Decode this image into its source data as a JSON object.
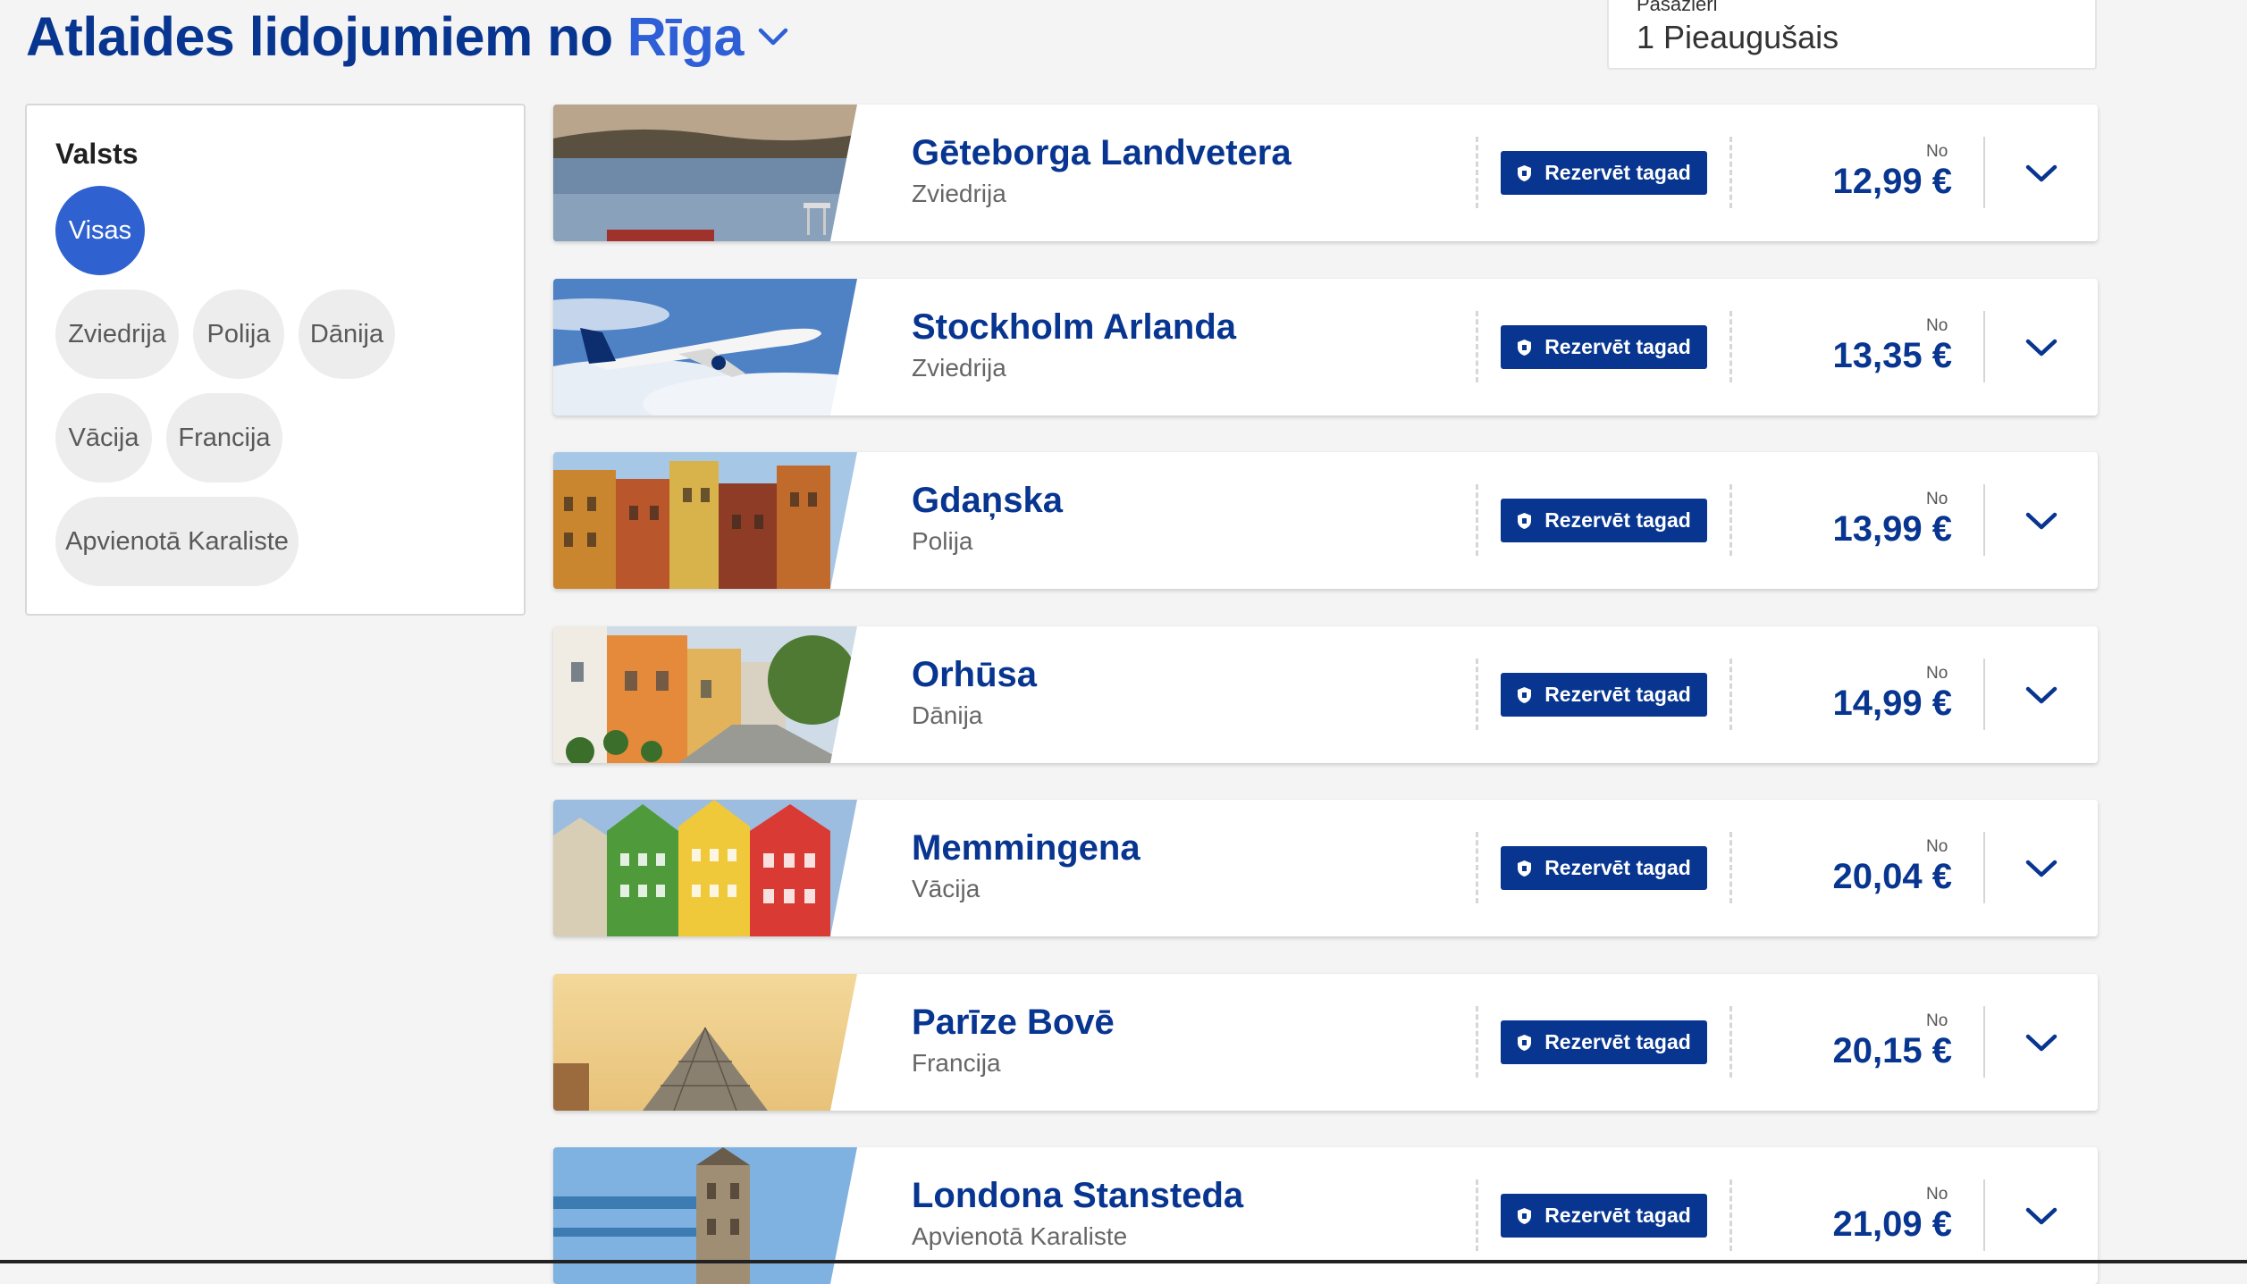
{
  "header": {
    "title_prefix": "Atlaides lidojumiem no",
    "origin_city": "Rīga",
    "passengers_label": "Pasažieri",
    "passengers_value": "1 Pieaugušais"
  },
  "filter": {
    "title": "Valsts",
    "chips": [
      {
        "label": "Visas",
        "active": true
      },
      {
        "label": "Zviedrija",
        "active": false
      },
      {
        "label": "Polija",
        "active": false
      },
      {
        "label": "Dānija",
        "active": false
      },
      {
        "label": "Vācija",
        "active": false
      },
      {
        "label": "Francija",
        "active": false
      },
      {
        "label": "Apvienotā Karaliste",
        "active": false
      }
    ]
  },
  "results": [
    {
      "city": "Gēteborga Landvetera",
      "country": "Zviedrija",
      "button": "Rezervēt tagad",
      "from": "No",
      "price": "12,99 €",
      "image": "lake-photo"
    },
    {
      "city": "Stockholm Arlanda",
      "country": "Zviedrija",
      "button": "Rezervēt tagad",
      "from": "No",
      "price": "13,35 €",
      "image": "airplane-photo"
    },
    {
      "city": "Gdaņska",
      "country": "Polija",
      "button": "Rezervēt tagad",
      "from": "No",
      "price": "13,99 €",
      "image": "old-town-photo"
    },
    {
      "city": "Orhūsa",
      "country": "Dānija",
      "button": "Rezervēt tagad",
      "from": "No",
      "price": "14,99 €",
      "image": "street-photo"
    },
    {
      "city": "Memmingena",
      "country": "Vācija",
      "button": "Rezervēt tagad",
      "from": "No",
      "price": "20,04 €",
      "image": "colorful-houses-photo"
    },
    {
      "city": "Parīze Bovē",
      "country": "Francija",
      "button": "Rezervēt tagad",
      "from": "No",
      "price": "20,15 €",
      "image": "louvre-photo"
    },
    {
      "city": "Londona Stansteda",
      "country": "Apvienotā Karaliste",
      "button": "Rezervēt tagad",
      "from": "No",
      "price": "21,09 €",
      "image": "tower-bridge-photo"
    }
  ],
  "colors": {
    "brand_navy": "#073590",
    "accent_blue": "#2f62d0",
    "background": "#f4f4f4"
  }
}
